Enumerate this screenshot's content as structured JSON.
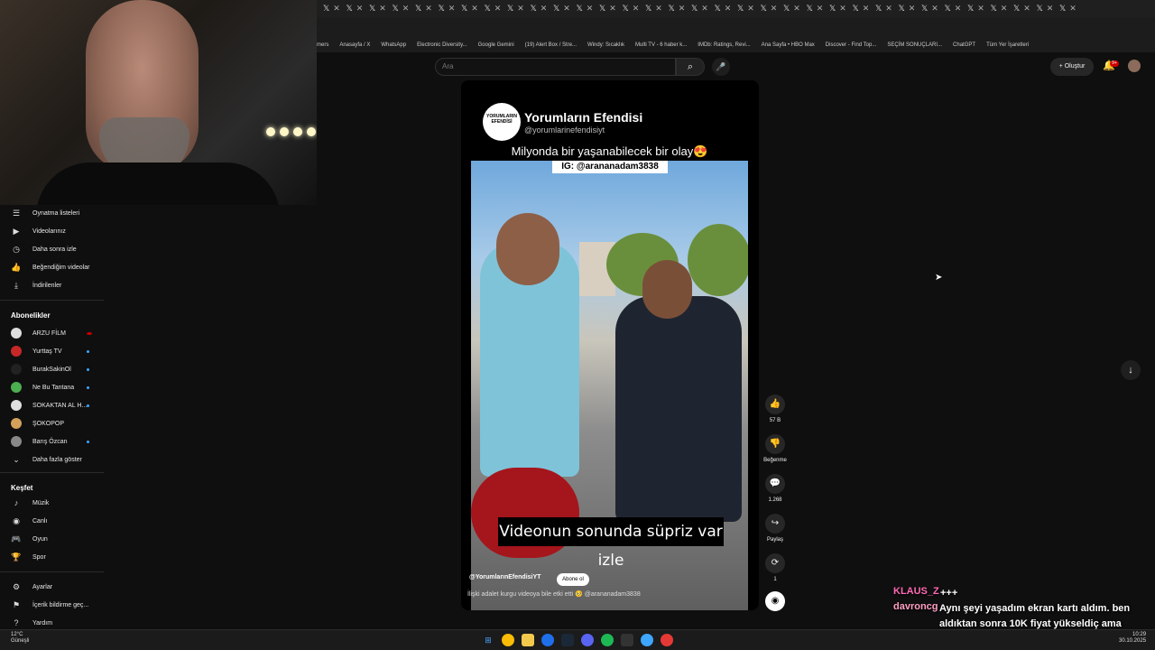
{
  "browser": {
    "tab_close_glyph": "✕",
    "tab_icon_glyph": "𝕏",
    "bookmarks": [
      "mers",
      "Anasayfa / X",
      "WhatsApp",
      "Electronic Diversity...",
      "Google Gemini",
      "(19) Alert Box / Stre...",
      "Windy: Sıcaklık",
      "Multi TV - 6 haber k...",
      "IMDb: Ratings, Revi...",
      "Ana Sayfa • HBO Max",
      "Discover - Find Top...",
      "SEÇİM SONUÇLARI...",
      "ChatGPT",
      "Tüm Yer İşaretleri"
    ]
  },
  "sidebar": {
    "items": [
      {
        "label": "Oynatma listeleri",
        "icon": "playlist-icon",
        "glyph": "☰"
      },
      {
        "label": "Videolarınız",
        "icon": "video-icon",
        "glyph": "▶"
      },
      {
        "label": "Daha sonra izle",
        "icon": "clock-icon",
        "glyph": "◷"
      },
      {
        "label": "Beğendiğim videolar",
        "icon": "thumbs-up-icon",
        "glyph": "👍"
      },
      {
        "label": "İndirilenler",
        "icon": "download-icon",
        "glyph": "⤓"
      }
    ],
    "subscriptions_heading": "Abonelikler",
    "subscriptions": [
      {
        "label": "ARZU FİLM",
        "color": "#dddddd",
        "live": true
      },
      {
        "label": "Yurttaş TV",
        "color": "#c62828",
        "dot": true
      },
      {
        "label": "BurakSakinOl",
        "color": "#222222",
        "dot": true
      },
      {
        "label": "Ne Bu Tantana",
        "color": "#4caf50",
        "dot": true
      },
      {
        "label": "SOKAKTAN AL H...",
        "color": "#e0e0e0",
        "dot": true
      },
      {
        "label": "ŞOKOPOP",
        "color": "#d4a15a",
        "dot": false
      },
      {
        "label": "Barış Özcan",
        "color": "#888888",
        "dot": true
      }
    ],
    "show_more": "Daha fazla göster",
    "explore_heading": "Keşfet",
    "explore": [
      {
        "label": "Müzik",
        "icon": "music-icon",
        "glyph": "♪"
      },
      {
        "label": "Canlı",
        "icon": "live-icon",
        "glyph": "◉"
      },
      {
        "label": "Oyun",
        "icon": "gamepad-icon",
        "glyph": "🎮"
      },
      {
        "label": "Spor",
        "icon": "trophy-icon",
        "glyph": "🏆"
      }
    ],
    "settings": [
      {
        "label": "Ayarlar",
        "icon": "gear-icon",
        "glyph": "⚙"
      },
      {
        "label": "İçerik bildirme geç...",
        "icon": "flag-icon",
        "glyph": "⚑"
      },
      {
        "label": "Yardım",
        "icon": "help-icon",
        "glyph": "?"
      }
    ]
  },
  "topbar": {
    "search_placeholder": "Ara",
    "create_label": "Oluştur",
    "notif_count": "9+"
  },
  "short": {
    "channel_name": "Yorumların Efendisi",
    "channel_handle": "@yorumlarinefendisiyt",
    "logo_text": "YORUMLARIN EFENDİSİ",
    "caption": "Milyonda bir yaşanabilecek bir olay😍",
    "ig_tag": "IG: @arananadam3838",
    "subtitle": "Videonun sonunda süpriz var izle",
    "video_channel": "@YorumlarınEfendisiYT",
    "subscribe_label": "Abone ol",
    "description": "İlişki adalet kurgu videoya bile etki etti 🥺 @arananadam3838"
  },
  "actions": {
    "like_count": "57 B",
    "dislike_label": "Beğenme",
    "comment_count": "1.268",
    "share_label": "Paylaş",
    "remix_count": "1"
  },
  "chat": [
    {
      "user": "KLAUS_Z",
      "user_color": "#ff69b4",
      "message": "+++"
    },
    {
      "user": "davroncg",
      "user_color": "#ff9ec4",
      "message": "Aynı şeyi yaşadım ekran kartı aldım. ben aldıktan sonra 10K fiyat yükseldiç ama benim ürünü iptal etmediler"
    }
  ],
  "taskbar": {
    "weather_temp": "12°C",
    "weather_desc": "Güneşli",
    "time": "10:29",
    "date": "30.10.2025"
  }
}
